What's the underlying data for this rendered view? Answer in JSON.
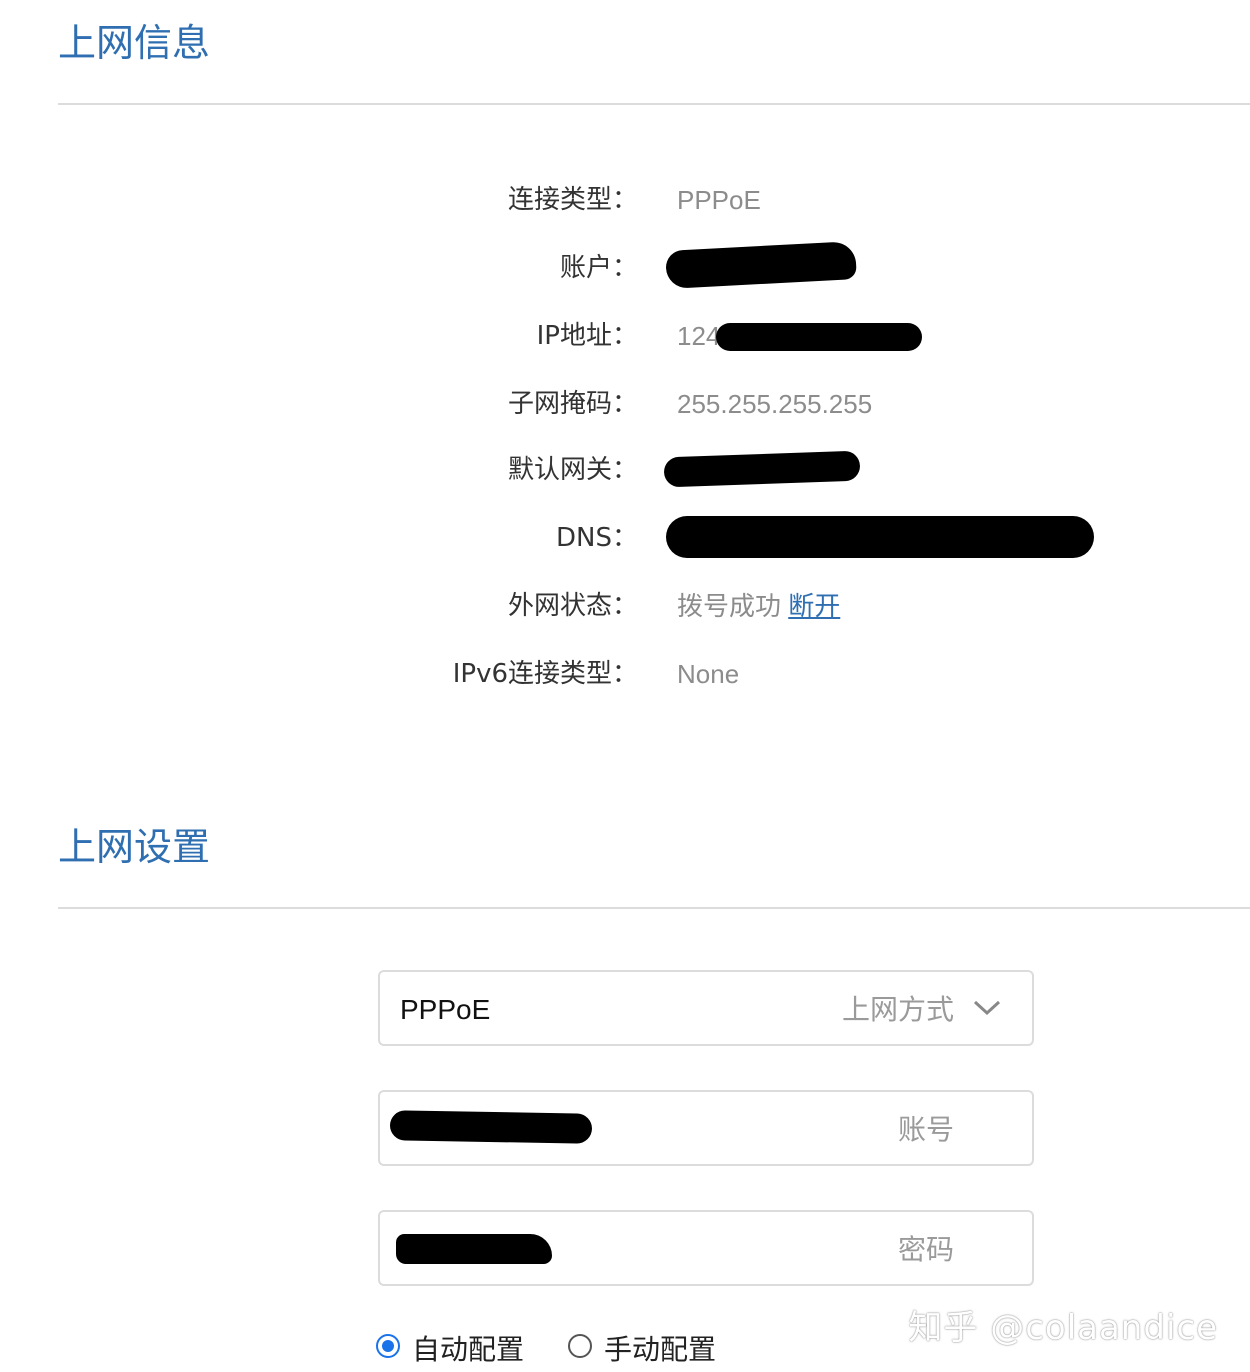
{
  "colors": {
    "accent": "#2f6fb1",
    "label_text": "#333333",
    "value_text": "#8c8c8c",
    "divider": "#dcdcdc",
    "radio_checked": "#1a73e8"
  },
  "info_section": {
    "title": "上网信息",
    "rows": [
      {
        "label": "连接类型：",
        "value": "PPPoE"
      },
      {
        "label": "账户：",
        "value": ""
      },
      {
        "label": "IP地址：",
        "value": "124"
      },
      {
        "label": "子网掩码：",
        "value": "255.255.255.255"
      },
      {
        "label": "默认网关：",
        "value": ""
      },
      {
        "label": "DNS：",
        "value": ""
      },
      {
        "label": "外网状态：",
        "value": "拨号成功",
        "link": "断开"
      },
      {
        "label": "IPv6连接类型：",
        "value": "None"
      }
    ]
  },
  "settings_section": {
    "title": "上网设置",
    "method_field": {
      "value": "PPPoE",
      "hint": "上网方式",
      "icon": "chevron-down-icon"
    },
    "account_field": {
      "value": "",
      "hint": "账号"
    },
    "password_field": {
      "value": "",
      "hint": "密码"
    },
    "radios": [
      {
        "label": "自动配置",
        "checked": true
      },
      {
        "label": "手动配置",
        "checked": false
      }
    ]
  },
  "watermark": "知乎 @colaandice"
}
